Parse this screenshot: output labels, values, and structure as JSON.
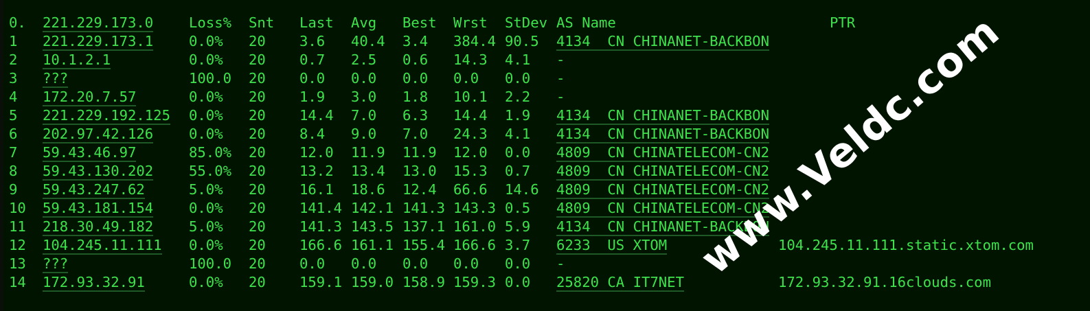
{
  "header": {
    "idx": "0.",
    "host": "221.229.173.0",
    "loss": "Loss%",
    "snt": "Snt",
    "last": "Last",
    "avg": "Avg",
    "best": "Best",
    "wrst": "Wrst",
    "stdev": "StDev",
    "as": "AS Name",
    "ptr": "PTR"
  },
  "rows": [
    {
      "idx": "1",
      "host": "221.229.173.1",
      "loss": "0.0%",
      "snt": "20",
      "last": "3.6",
      "avg": "40.4",
      "best": "3.4",
      "wrst": "384.4",
      "stdev": "90.5",
      "as": "4134  CN CHINANET-BACKBON",
      "ptr": ""
    },
    {
      "idx": "2",
      "host": "10.1.2.1",
      "loss": "0.0%",
      "snt": "20",
      "last": "0.7",
      "avg": "2.5",
      "best": "0.6",
      "wrst": "14.3",
      "stdev": "4.1",
      "as": "-",
      "ptr": ""
    },
    {
      "idx": "3",
      "host": "???",
      "loss": "100.0",
      "snt": "20",
      "last": "0.0",
      "avg": "0.0",
      "best": "0.0",
      "wrst": "0.0",
      "stdev": "0.0",
      "as": "-",
      "ptr": ""
    },
    {
      "idx": "4",
      "host": "172.20.7.57",
      "loss": "0.0%",
      "snt": "20",
      "last": "1.9",
      "avg": "3.0",
      "best": "1.8",
      "wrst": "10.1",
      "stdev": "2.2",
      "as": "-",
      "ptr": ""
    },
    {
      "idx": "5",
      "host": "221.229.192.125",
      "loss": "0.0%",
      "snt": "20",
      "last": "14.4",
      "avg": "7.0",
      "best": "6.3",
      "wrst": "14.4",
      "stdev": "1.9",
      "as": "4134  CN CHINANET-BACKBON",
      "ptr": ""
    },
    {
      "idx": "6",
      "host": "202.97.42.126",
      "loss": "0.0%",
      "snt": "20",
      "last": "8.4",
      "avg": "9.0",
      "best": "7.0",
      "wrst": "24.3",
      "stdev": "4.1",
      "as": "4134  CN CHINANET-BACKBON",
      "ptr": ""
    },
    {
      "idx": "7",
      "host": "59.43.46.97",
      "loss": "85.0%",
      "snt": "20",
      "last": "12.0",
      "avg": "11.9",
      "best": "11.9",
      "wrst": "12.0",
      "stdev": "0.0",
      "as": "4809  CN CHINATELECOM-CN2",
      "ptr": ""
    },
    {
      "idx": "8",
      "host": "59.43.130.202",
      "loss": "55.0%",
      "snt": "20",
      "last": "13.2",
      "avg": "13.4",
      "best": "13.0",
      "wrst": "15.3",
      "stdev": "0.7",
      "as": "4809  CN CHINATELECOM-CN2",
      "ptr": ""
    },
    {
      "idx": "9",
      "host": "59.43.247.62",
      "loss": "5.0%",
      "snt": "20",
      "last": "16.1",
      "avg": "18.6",
      "best": "12.4",
      "wrst": "66.6",
      "stdev": "14.6",
      "as": "4809  CN CHINATELECOM-CN2",
      "ptr": ""
    },
    {
      "idx": "10",
      "host": "59.43.181.154",
      "loss": "0.0%",
      "snt": "20",
      "last": "141.4",
      "avg": "142.1",
      "best": "141.3",
      "wrst": "143.3",
      "stdev": "0.5",
      "as": "4809  CN CHINATELECOM-CN2",
      "ptr": ""
    },
    {
      "idx": "11",
      "host": "218.30.49.182",
      "loss": "5.0%",
      "snt": "20",
      "last": "141.3",
      "avg": "143.5",
      "best": "137.1",
      "wrst": "161.0",
      "stdev": "5.9",
      "as": "4134  CN CHINANET-BACKBON",
      "ptr": ""
    },
    {
      "idx": "12",
      "host": "104.245.11.111",
      "loss": "0.0%",
      "snt": "20",
      "last": "166.6",
      "avg": "161.1",
      "best": "155.4",
      "wrst": "166.6",
      "stdev": "3.7",
      "as": "6233  US XTOM",
      "ptr": "104.245.11.111.static.xtom.com"
    },
    {
      "idx": "13",
      "host": "???",
      "loss": "100.0",
      "snt": "20",
      "last": "0.0",
      "avg": "0.0",
      "best": "0.0",
      "wrst": "0.0",
      "stdev": "0.0",
      "as": "-",
      "ptr": ""
    },
    {
      "idx": "14",
      "host": "172.93.32.91",
      "loss": "0.0%",
      "snt": "20",
      "last": "159.1",
      "avg": "159.0",
      "best": "158.9",
      "wrst": "159.3",
      "stdev": "0.0",
      "as": "25820 CA IT7NET",
      "ptr": "172.93.32.91.16clouds.com"
    }
  ],
  "watermark": "www.Veldc.com"
}
